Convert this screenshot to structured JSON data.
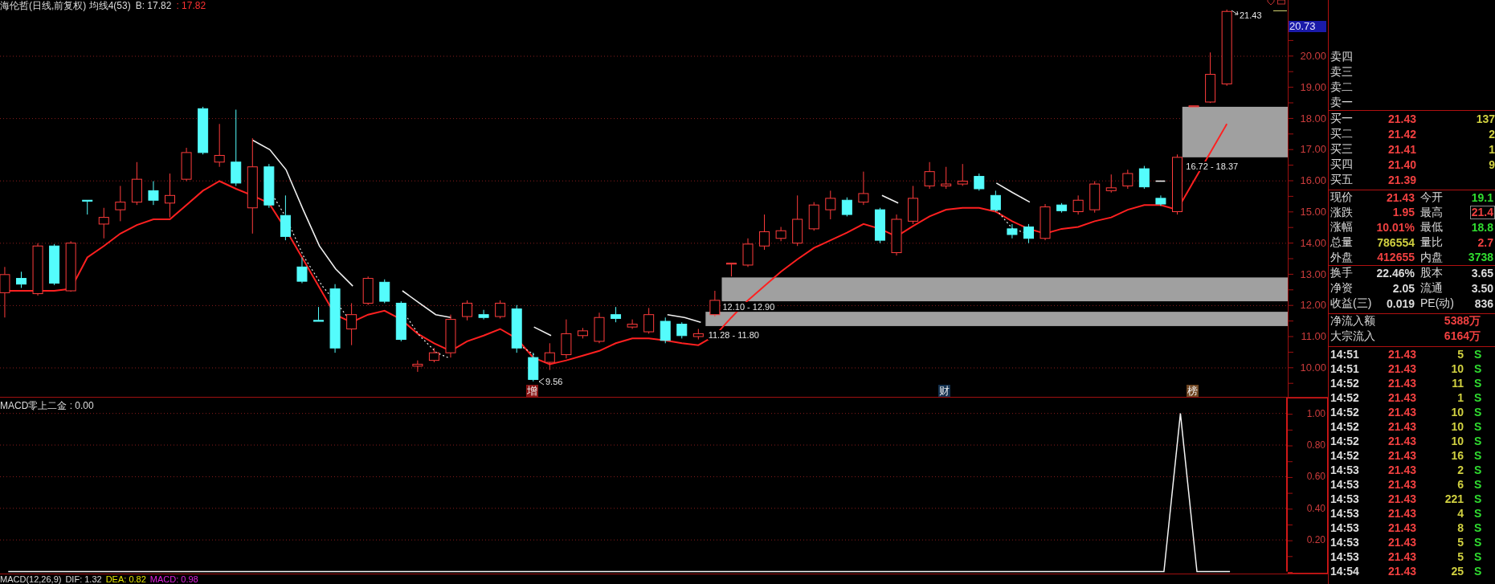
{
  "chart_header": {
    "title": "海伦哲(日线,前复权) 均线4(53)",
    "readings": [
      {
        "text": "B: 17.82",
        "color": "#dcdcdc"
      },
      {
        "text": ": 17.82",
        "color": "#ff3232"
      }
    ]
  },
  "price_chart": {
    "price_axis": [
      "20.00",
      "19.00",
      "18.00",
      "17.00",
      "16.00",
      "15.00",
      "14.00",
      "13.00",
      "12.00",
      "11.00",
      "10.00"
    ],
    "price_tag": "20.73",
    "high_label": "21.43",
    "low_label": "9.56",
    "zones": [
      {
        "label": "16.72 - 18.37"
      },
      {
        "label": "12.10 - 12.90"
      },
      {
        "label": "11.28 - 11.80"
      }
    ],
    "event_marks": [
      {
        "text": "增",
        "color": "#8a1414"
      },
      {
        "text": "财",
        "color": "#12304e"
      },
      {
        "text": "榜",
        "color": "#6e4420"
      }
    ]
  },
  "indicator_panel": {
    "title": "MACD零上二金 : 0.00",
    "chart_data": {
      "type": "line",
      "grid": true,
      "ylim": [
        0,
        1.1
      ],
      "yticks": [
        {
          "value": 1,
          "label": "1.00"
        },
        {
          "value": 0.8,
          "label": "0.80"
        },
        {
          "value": 0.6,
          "label": "0.60"
        },
        {
          "value": 0.4,
          "label": "0.40"
        },
        {
          "value": 0.2,
          "label": "0.20"
        }
      ],
      "values": [
        0,
        0,
        0,
        0,
        0,
        0,
        0,
        0,
        0,
        0,
        0,
        0,
        0,
        0,
        0,
        0,
        0,
        0,
        0,
        0,
        0,
        0,
        0,
        0,
        0,
        0,
        0,
        0,
        0,
        0,
        0,
        0,
        0,
        0,
        0,
        0,
        0,
        0,
        0,
        0,
        0,
        0,
        0,
        0,
        0,
        0,
        0,
        0,
        0,
        0,
        0,
        0,
        0,
        0,
        0,
        0,
        0,
        0,
        0,
        0,
        0,
        0,
        0,
        0,
        0,
        0,
        0,
        0,
        0,
        0,
        0,
        1,
        0,
        0,
        0,
        null,
        null,
        null
      ]
    }
  },
  "macd_legend": [
    {
      "text": "MACD(12,26,9)",
      "color": "#dcdcdc"
    },
    {
      "text": "DIF: 1.32",
      "color": "#dcdcdc"
    },
    {
      "text": "DEA: 0.82",
      "color": "#e6e600"
    },
    {
      "text": "MACD: 0.98",
      "color": "#e020e0"
    }
  ],
  "quote_panel": {
    "asks": [
      {
        "label": "卖四"
      },
      {
        "label": "卖三"
      },
      {
        "label": "卖二"
      },
      {
        "label": "卖一"
      }
    ],
    "bids": [
      {
        "label": "买一",
        "price": "21.43",
        "volume": "137"
      },
      {
        "label": "买二",
        "price": "21.42",
        "volume": "2"
      },
      {
        "label": "买三",
        "price": "21.41",
        "volume": "1"
      },
      {
        "label": "买四",
        "price": "21.40",
        "volume": "9"
      },
      {
        "label": "买五",
        "price": "21.39"
      }
    ],
    "quote": [
      {
        "label": "现价",
        "value": "21.43",
        "color": "#f04040",
        "highlighted": false
      },
      {
        "label": "今开",
        "value": "19.1",
        "color": "#30dc30",
        "highlighted": false
      },
      {
        "label": "涨跌",
        "value": "1.95",
        "color": "#f04040",
        "highlighted": false
      },
      {
        "label": "最高",
        "value": "21.4",
        "color": "#f04040",
        "highlighted": true
      },
      {
        "label": "涨幅",
        "value": "10.01%",
        "color": "#f04040",
        "highlighted": false
      },
      {
        "label": "最低",
        "value": "18.8",
        "color": "#30dc30",
        "highlighted": false
      },
      {
        "label": "总量",
        "value": "786554",
        "color": "#d0d040",
        "highlighted": false
      },
      {
        "label": "量比",
        "value": "2.7",
        "color": "#f04040",
        "highlighted": false
      },
      {
        "label": "外盘",
        "value": "412655",
        "color": "#f04040",
        "highlighted": false
      },
      {
        "label": "内盘",
        "value": "3738",
        "color": "#30dc30",
        "highlighted": false
      }
    ],
    "fundamentals": [
      {
        "label": "换手",
        "value": "22.46%"
      },
      {
        "label": "股本",
        "value": "3.65"
      },
      {
        "label": "净资",
        "value": "2.05"
      },
      {
        "label": "流通",
        "value": "3.50"
      },
      {
        "label": "收益(三)",
        "value": "0.019"
      },
      {
        "label": "PE(动)",
        "value": "836"
      }
    ],
    "flows": [
      {
        "label": "净流入额",
        "value": "5388万"
      },
      {
        "label": "大宗流入",
        "value": "6164万"
      }
    ],
    "ticks": [
      {
        "time": "14:51",
        "price": "21.43",
        "volume": "5",
        "side": "S"
      },
      {
        "time": "14:51",
        "price": "21.43",
        "volume": "10",
        "side": "S"
      },
      {
        "time": "14:52",
        "price": "21.43",
        "volume": "11",
        "side": "S"
      },
      {
        "time": "14:52",
        "price": "21.43",
        "volume": "1",
        "side": "S"
      },
      {
        "time": "14:52",
        "price": "21.43",
        "volume": "10",
        "side": "S"
      },
      {
        "time": "14:52",
        "price": "21.43",
        "volume": "10",
        "side": "S"
      },
      {
        "time": "14:52",
        "price": "21.43",
        "volume": "10",
        "side": "S"
      },
      {
        "time": "14:52",
        "price": "21.43",
        "volume": "16",
        "side": "S"
      },
      {
        "time": "14:53",
        "price": "21.43",
        "volume": "2",
        "side": "S"
      },
      {
        "time": "14:53",
        "price": "21.43",
        "volume": "6",
        "side": "S"
      },
      {
        "time": "14:53",
        "price": "21.43",
        "volume": "221",
        "side": "S"
      },
      {
        "time": "14:53",
        "price": "21.43",
        "volume": "4",
        "side": "S"
      },
      {
        "time": "14:53",
        "price": "21.43",
        "volume": "8",
        "side": "S"
      },
      {
        "time": "14:53",
        "price": "21.43",
        "volume": "5",
        "side": "S"
      },
      {
        "time": "14:53",
        "price": "21.43",
        "volume": "5",
        "side": "S"
      },
      {
        "time": "14:54",
        "price": "21.43",
        "volume": "25",
        "side": "S"
      }
    ]
  }
}
